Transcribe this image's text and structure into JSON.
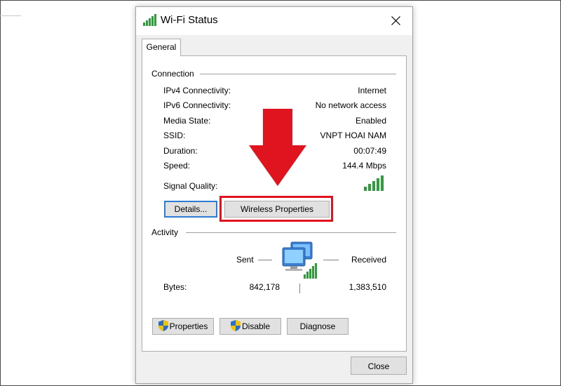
{
  "window": {
    "title": "Wi-Fi Status",
    "close_icon": "close-icon"
  },
  "tabs": [
    {
      "label": "General"
    }
  ],
  "connection": {
    "heading": "Connection",
    "rows": [
      {
        "label": "IPv4 Connectivity:",
        "value": "Internet"
      },
      {
        "label": "IPv6 Connectivity:",
        "value": "No network access"
      },
      {
        "label": "Media State:",
        "value": "Enabled"
      },
      {
        "label": "SSID:",
        "value": "VNPT HOAI NAM"
      },
      {
        "label": "Duration:",
        "value": "00:07:49"
      },
      {
        "label": "Speed:",
        "value": "144.4 Mbps"
      }
    ],
    "signal_label": "Signal Quality:",
    "signal_bars": 5,
    "details_button": "Details...",
    "wireless_button": "Wireless Properties"
  },
  "activity": {
    "heading": "Activity",
    "sent_label": "Sent",
    "received_label": "Received",
    "bytes_label": "Bytes:",
    "bytes_sent": "842,178",
    "bytes_received": "1,383,510"
  },
  "actions": {
    "properties": "Properties",
    "disable": "Disable",
    "diagnose": "Diagnose"
  },
  "footer": {
    "close": "Close"
  },
  "colors": {
    "signal_green": "#2e9e3a",
    "highlight_red": "#e0141e",
    "default_blue": "#2e7bd6"
  }
}
